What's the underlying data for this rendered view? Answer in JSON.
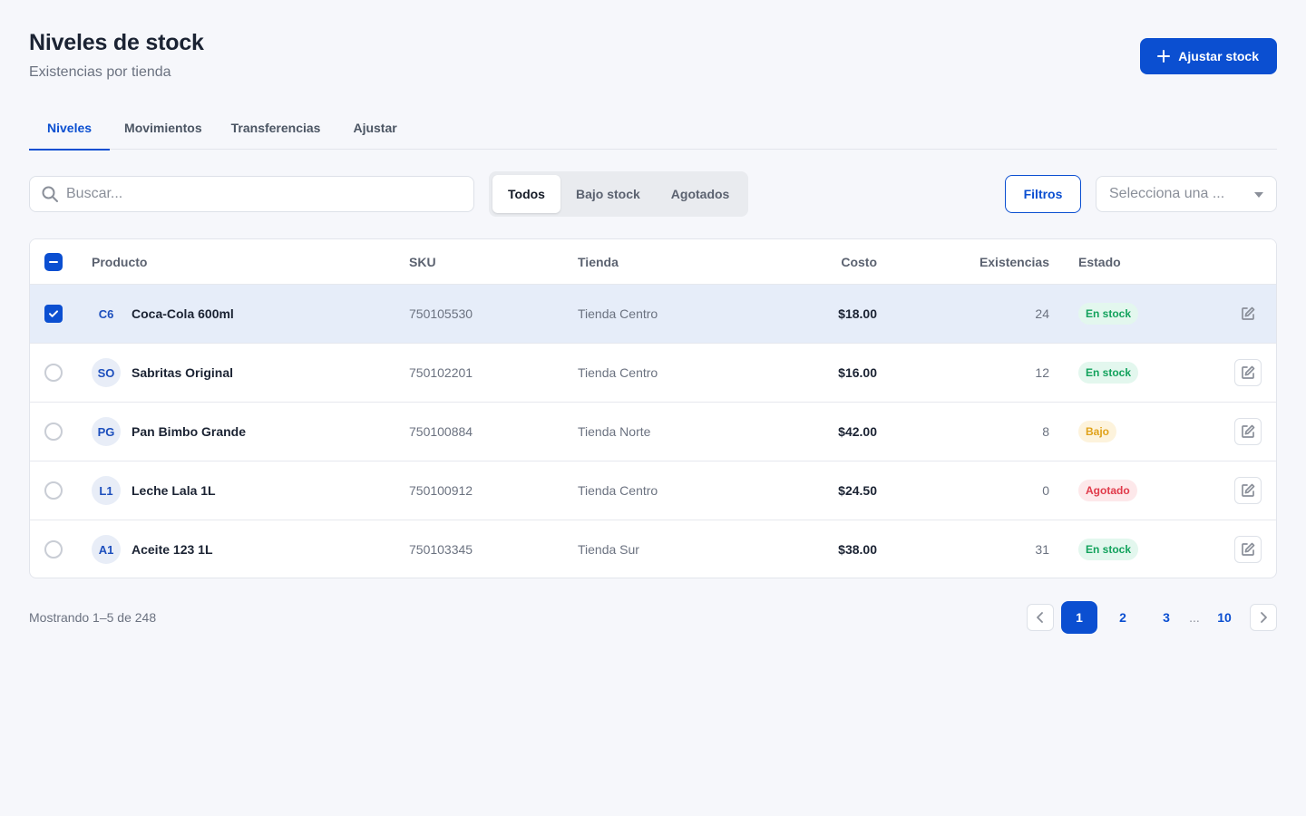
{
  "header": {
    "title": "Niveles de stock",
    "subtitle": "Existencias por tienda",
    "primary_action": "Ajustar stock"
  },
  "tabs": [
    {
      "label": "Niveles",
      "active": true
    },
    {
      "label": "Movimientos",
      "active": false
    },
    {
      "label": "Transferencias",
      "active": false
    },
    {
      "label": "Ajustar",
      "active": false
    }
  ],
  "toolbar": {
    "search_placeholder": "Buscar...",
    "segments": [
      {
        "label": "Todos",
        "active": true
      },
      {
        "label": "Bajo stock",
        "active": false
      },
      {
        "label": "Agotados",
        "active": false
      }
    ],
    "filters_label": "Filtros",
    "select_placeholder": "Selecciona una ..."
  },
  "table": {
    "columns": {
      "product": "Producto",
      "sku": "SKU",
      "store": "Tienda",
      "cost": "Costo",
      "stock": "Existencias",
      "status": "Estado"
    },
    "rows": [
      {
        "initials": "C6",
        "product": "Coca-Cola 600ml",
        "sku": "750105530",
        "store": "Tienda Centro",
        "cost": "$18.00",
        "stock": "24",
        "status": "En stock",
        "selected": true
      },
      {
        "initials": "SO",
        "product": "Sabritas Original",
        "sku": "750102201",
        "store": "Tienda Centro",
        "cost": "$16.00",
        "stock": "12",
        "status": "En stock",
        "selected": false
      },
      {
        "initials": "PG",
        "product": "Pan Bimbo Grande",
        "sku": "750100884",
        "store": "Tienda Norte",
        "cost": "$42.00",
        "stock": "8",
        "status": "Bajo",
        "selected": false
      },
      {
        "initials": "L1",
        "product": "Leche Lala 1L",
        "sku": "750100912",
        "store": "Tienda Centro",
        "cost": "$24.50",
        "stock": "0",
        "status": "Agotado",
        "selected": false
      },
      {
        "initials": "A1",
        "product": "Aceite 123 1L",
        "sku": "750103345",
        "store": "Tienda Sur",
        "cost": "$38.00",
        "stock": "31",
        "status": "En stock",
        "selected": false
      }
    ]
  },
  "status_colors": {
    "En stock": {
      "bg": "#e3f7ee",
      "fg": "#12a25c"
    },
    "Bajo": {
      "bg": "#fdf3dc",
      "fg": "#e0a21a"
    },
    "Agotado": {
      "bg": "#fde8ea",
      "fg": "#e03a4a"
    }
  },
  "pagination": {
    "summary": "Mostrando 1–5 de 248",
    "pages": [
      "1",
      "2",
      "3"
    ],
    "ellipsis": "...",
    "last_page": "10",
    "current": "1"
  },
  "colors": {
    "accent": "#0b4fd1",
    "background": "#f6f7fb"
  },
  "icons": {
    "add": "plus-icon",
    "search": "search-icon",
    "dropdown": "chevron-down-icon",
    "edit": "edit-icon",
    "prev": "chevron-left-icon",
    "next": "chevron-right-icon"
  }
}
